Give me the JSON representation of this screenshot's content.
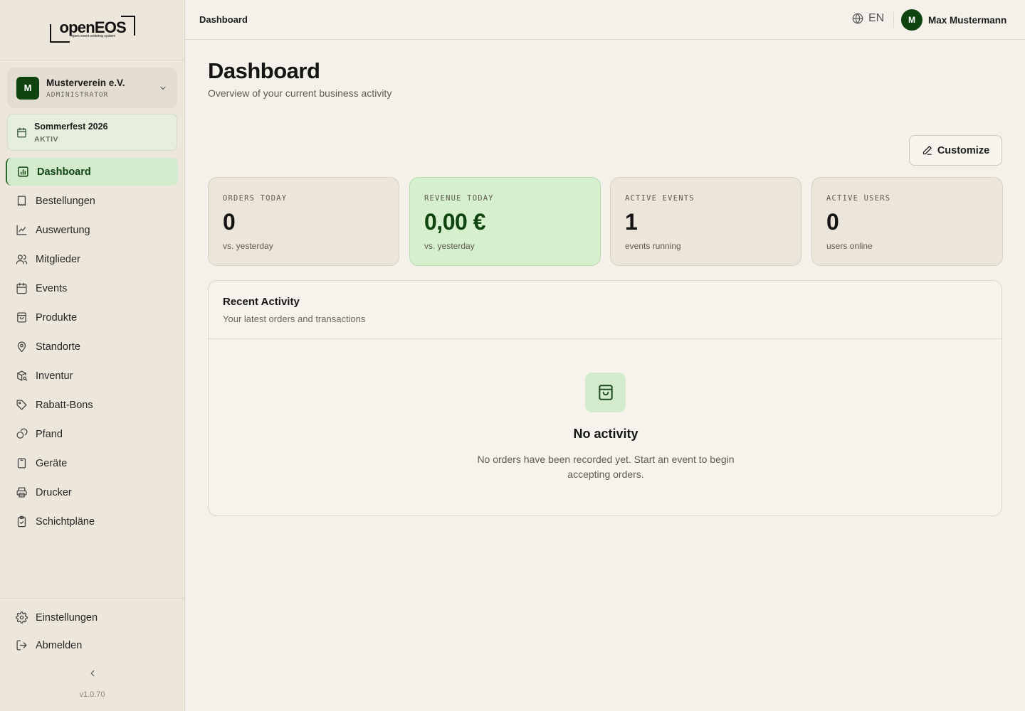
{
  "logo": {
    "name": "openEOS",
    "tagline": "open event ordering system"
  },
  "org": {
    "initial": "M",
    "name": "Musterverein e.V.",
    "role": "ADMINISTRATOR"
  },
  "event": {
    "name": "Sommerfest 2026",
    "status": "AKTIV"
  },
  "nav": {
    "items": [
      {
        "label": "Dashboard",
        "icon": "bar-chart-icon",
        "active": true
      },
      {
        "label": "Bestellungen",
        "icon": "receipt-icon"
      },
      {
        "label": "Auswertung",
        "icon": "line-chart-icon"
      },
      {
        "label": "Mitglieder",
        "icon": "users-icon"
      },
      {
        "label": "Events",
        "icon": "calendar-icon"
      },
      {
        "label": "Produkte",
        "icon": "shopping-bag-icon"
      },
      {
        "label": "Standorte",
        "icon": "map-pin-icon"
      },
      {
        "label": "Inventur",
        "icon": "package-search-icon"
      },
      {
        "label": "Rabatt-Bons",
        "icon": "tag-icon"
      },
      {
        "label": "Pfand",
        "icon": "coins-icon"
      },
      {
        "label": "Geräte",
        "icon": "tablet-icon"
      },
      {
        "label": "Drucker",
        "icon": "printer-icon"
      },
      {
        "label": "Schichtpläne",
        "icon": "clipboard-check-icon"
      }
    ],
    "bottom": [
      {
        "label": "Einstellungen",
        "icon": "gear-icon"
      },
      {
        "label": "Abmelden",
        "icon": "logout-icon"
      }
    ]
  },
  "version": "v1.0.70",
  "topbar": {
    "breadcrumb": "Dashboard",
    "language": "EN",
    "user_initial": "M",
    "user_name": "Max Mustermann"
  },
  "page": {
    "title": "Dashboard",
    "subtitle": "Overview of your current business activity",
    "customize_label": "Customize"
  },
  "stats": [
    {
      "label": "ORDERS TODAY",
      "value": "0",
      "note": "vs. yesterday"
    },
    {
      "label": "REVENUE TODAY",
      "value": "0,00 €",
      "note": "vs. yesterday"
    },
    {
      "label": "ACTIVE EVENTS",
      "value": "1",
      "note": "events running"
    },
    {
      "label": "ACTIVE USERS",
      "value": "0",
      "note": "users online"
    }
  ],
  "activity": {
    "title": "Recent Activity",
    "subtitle": "Your latest orders and transactions",
    "empty_title": "No activity",
    "empty_text": "No orders have been recorded yet. Start an event to begin accepting orders."
  },
  "colors": {
    "brand": "#0f4310",
    "accent_light": "#d3ebcc",
    "background": "#f4f1ea",
    "sidebar": "#ece6db"
  }
}
